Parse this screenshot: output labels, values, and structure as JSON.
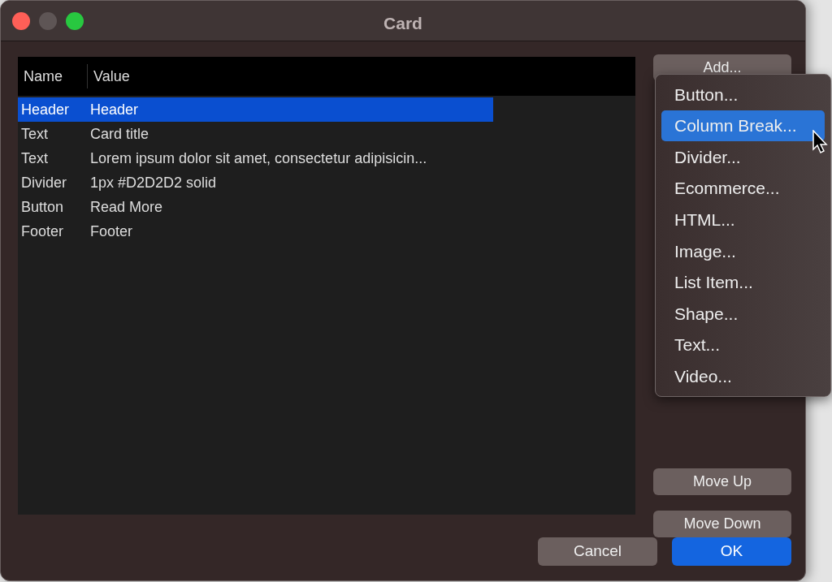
{
  "window": {
    "title": "Card"
  },
  "table": {
    "columns": [
      "Name",
      "Value"
    ],
    "rows": [
      {
        "name": "Header",
        "value": "Header",
        "selected": true
      },
      {
        "name": "Text",
        "value": "Card title",
        "selected": false
      },
      {
        "name": "Text",
        "value": "Lorem ipsum dolor sit amet, consectetur adipisicin...",
        "selected": false
      },
      {
        "name": "Divider",
        "value": "1px #D2D2D2 solid",
        "selected": false
      },
      {
        "name": "Button",
        "value": "Read More",
        "selected": false
      },
      {
        "name": "Footer",
        "value": "Footer",
        "selected": false
      }
    ]
  },
  "side_buttons": [
    {
      "label": "Add..."
    },
    {
      "label": "Move Up"
    },
    {
      "label": "Move Down"
    }
  ],
  "menu": {
    "items": [
      {
        "label": "Button...",
        "selected": false
      },
      {
        "label": "Column Break...",
        "selected": true
      },
      {
        "label": "Divider...",
        "selected": false
      },
      {
        "label": "Ecommerce...",
        "selected": false
      },
      {
        "label": "HTML...",
        "selected": false
      },
      {
        "label": "Image...",
        "selected": false
      },
      {
        "label": "List Item...",
        "selected": false
      },
      {
        "label": "Shape...",
        "selected": false
      },
      {
        "label": "Text...",
        "selected": false
      },
      {
        "label": "Video...",
        "selected": false
      }
    ]
  },
  "footer_buttons": [
    {
      "label": "Cancel",
      "kind": "secondary"
    },
    {
      "label": "OK",
      "kind": "primary"
    }
  ]
}
